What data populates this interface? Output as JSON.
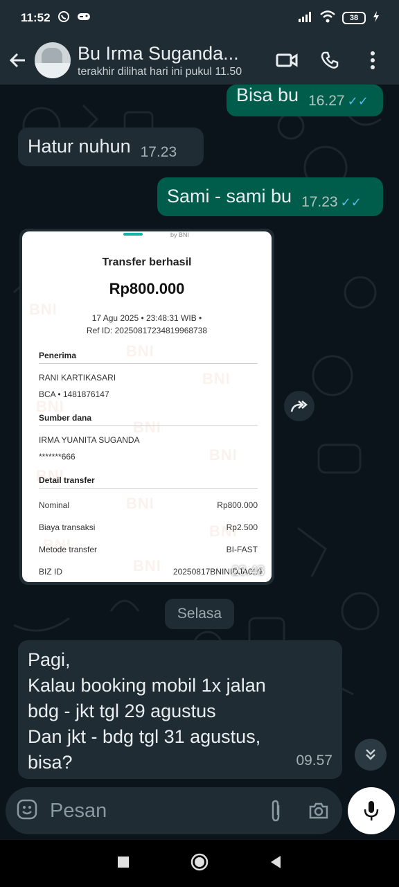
{
  "status": {
    "time": "11:52",
    "battery": "38"
  },
  "header": {
    "name": "Bu Irma Suganda...",
    "last_seen": "terakhir dilihat hari ini pukul 11.50"
  },
  "messages": [
    {
      "text": "Bisa bu",
      "time": "16.27"
    },
    {
      "text": "Hatur nuhun",
      "time": "17.23"
    },
    {
      "text": "Sami - sami bu",
      "time": "17.23"
    }
  ],
  "receipt": {
    "by": "by BNI",
    "title": "Transfer berhasil",
    "amount": "Rp800.000",
    "date": "17 Agu 2025 • 23:48:31 WIB •",
    "ref": "Ref ID: 20250817234819968738",
    "penerima_label": "Penerima",
    "penerima_name": "RANI KARTIKASARI",
    "penerima_account": "BCA • 1481876147",
    "sumber_label": "Sumber dana",
    "sumber_name": "IRMA YUANITA SUGANDA",
    "sumber_account": "*******666",
    "detail_label": "Detail transfer",
    "nominal_label": "Nominal",
    "nominal_value": "Rp800.000",
    "biaya_label": "Biaya transaksi",
    "biaya_value": "Rp2.500",
    "metode_label": "Metode transfer",
    "metode_value": "BI-FAST",
    "biz_label": "BIZ ID",
    "biz_value": "20250817BNINIDJA010",
    "time": "23.48"
  },
  "date_chip": "Selasa",
  "last_message": {
    "lines": [
      "Pagi,",
      "Kalau booking mobil 1x jalan",
      "bdg - jkt tgl 29 agustus",
      "Dan jkt - bdg tgl 31 agustus,",
      "bisa?"
    ],
    "time": "09.57"
  },
  "input": {
    "placeholder": "Pesan"
  },
  "colors": {
    "outgoing_bubble": "#005c4b",
    "incoming_bubble": "#1f2c34",
    "background": "#0b141a",
    "read_ticks": "#53bdeb"
  }
}
